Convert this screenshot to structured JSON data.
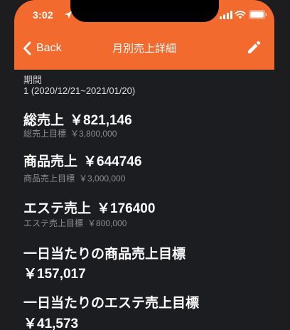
{
  "status_bar": {
    "time": "3:02"
  },
  "nav": {
    "back_label": "Back",
    "title": "月別売上詳細"
  },
  "period": {
    "label": "期間",
    "value": "1 (2020/12/21~2021/01/20)"
  },
  "total_sales": {
    "label": "総売上",
    "amount": "￥821,146",
    "target_label": "総売上目標",
    "target_amount": "￥3,800,000"
  },
  "product_sales": {
    "label": "商品売上",
    "amount": "￥644746",
    "target_label": "商品売上目標",
    "target_amount": "￥3,000,000"
  },
  "esthe_sales": {
    "label": "エステ売上",
    "amount": "￥176400",
    "target_label": "エステ売上目標",
    "target_amount": "￥800,000"
  },
  "daily_product_target": {
    "label": "一日当たりの商品売上目標",
    "amount": "￥157,017"
  },
  "daily_esthe_target": {
    "label": "一日当たりのエステ売上目標",
    "amount": "￥41,573"
  },
  "colors": {
    "header": "#f26a2e",
    "background": "#1c1d21"
  }
}
